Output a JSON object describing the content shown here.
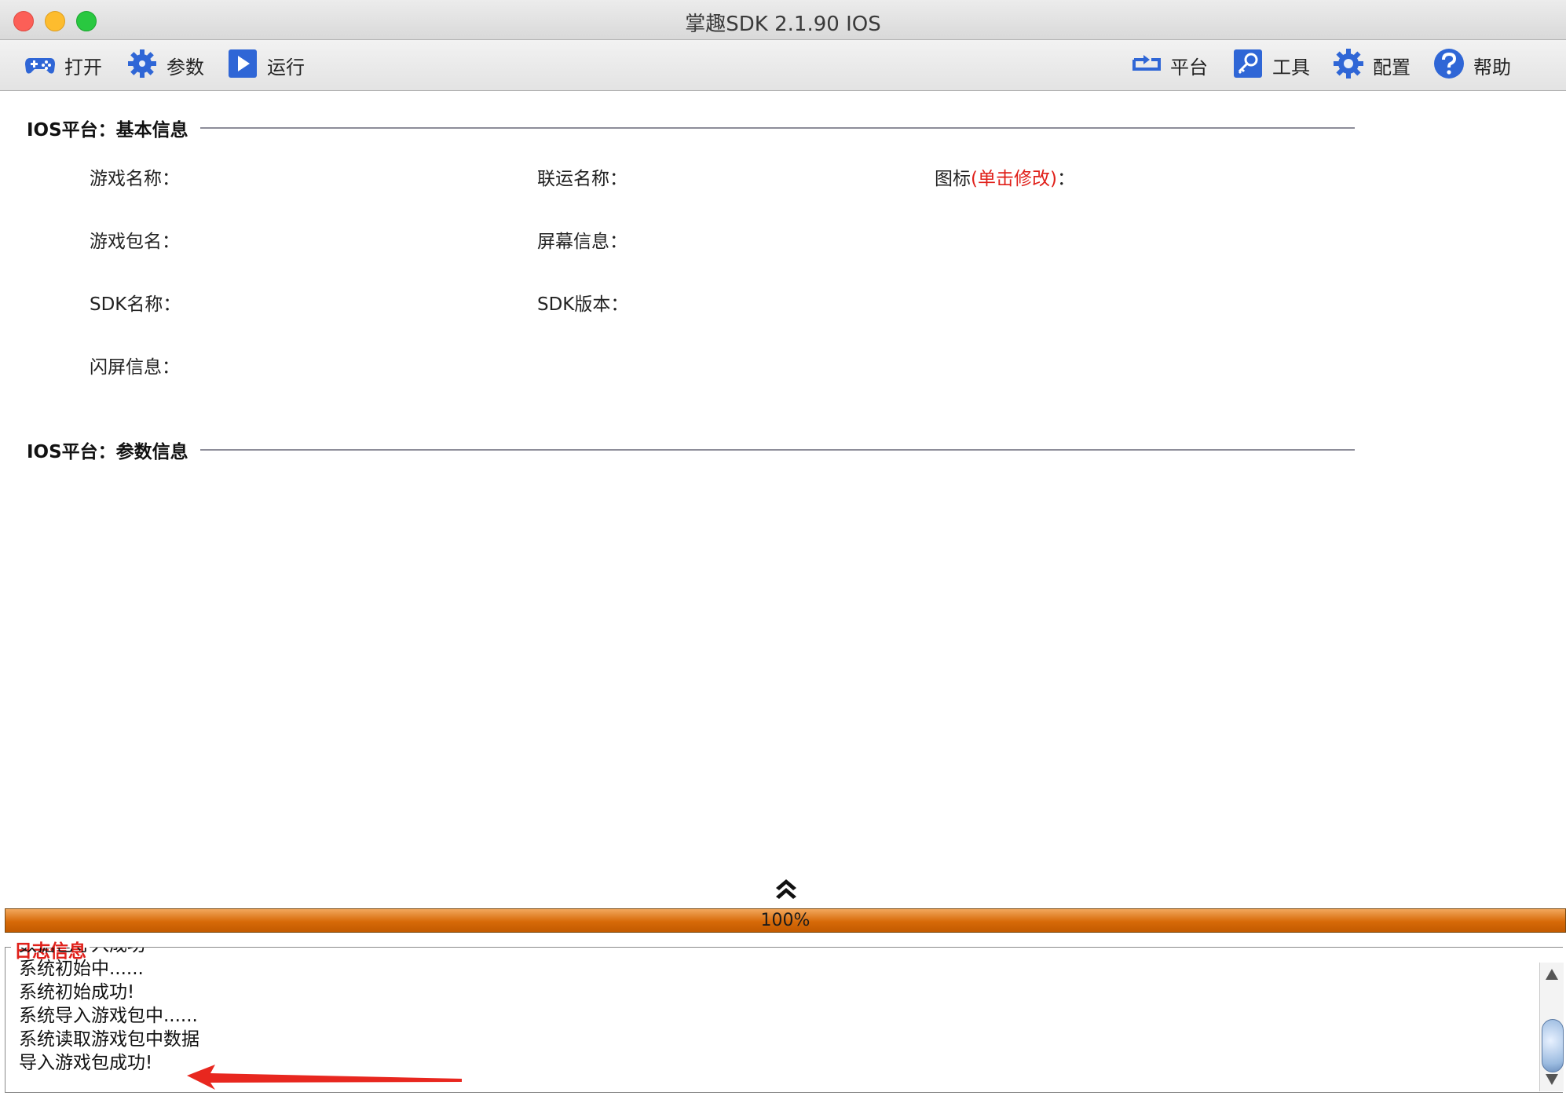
{
  "window": {
    "title": "掌趣SDK 2.1.90  IOS"
  },
  "toolbar": {
    "left": [
      {
        "label": "打开",
        "icon": "gamepad-icon"
      },
      {
        "label": "参数",
        "icon": "gear-icon"
      },
      {
        "label": "运行",
        "icon": "play-icon"
      }
    ],
    "right": [
      {
        "label": "平台",
        "icon": "switch-icon"
      },
      {
        "label": "工具",
        "icon": "key-icon"
      },
      {
        "label": "配置",
        "icon": "settings-icon"
      },
      {
        "label": "帮助",
        "icon": "help-icon"
      }
    ]
  },
  "basic_info": {
    "header": "IOS平台：基本信息",
    "game_name_label": "游戏名称：",
    "union_name_label": "联运名称：",
    "icon_label_prefix": "图标",
    "icon_label_hint": "(单击修改)",
    "icon_label_suffix": "：",
    "package_name_label": "游戏包名：",
    "screen_info_label": "屏幕信息：",
    "sdk_name_label": "SDK名称：",
    "sdk_version_label": "SDK版本：",
    "splash_info_label": "闪屏信息："
  },
  "param_info": {
    "header": "IOS平台：参数信息"
  },
  "progress": {
    "value": 100,
    "text": "100%",
    "color": "#d76a08"
  },
  "log": {
    "title": "日志信息",
    "lines": [
      "数据包导入成功",
      "系统初始中......",
      "系统初始成功!",
      "系统导入游戏包中......",
      "系统读取游戏包中数据",
      "导入游戏包成功!"
    ],
    "accent_color": "#e0201a"
  }
}
